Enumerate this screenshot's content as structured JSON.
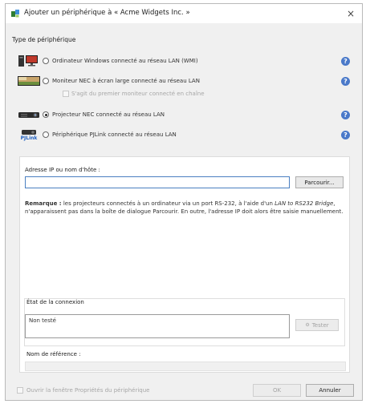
{
  "title": "Ajouter un périphérique à « Acme Widgets Inc. »",
  "close_glyph": "×",
  "device_type": {
    "label": "Type de périphérique",
    "options": [
      {
        "label": "Ordinateur Windows connecté au réseau LAN (WMI)",
        "icon": "computer-icon",
        "selected": false
      },
      {
        "label": "Moniteur NEC à écran large connecté au réseau LAN",
        "icon": "monitor-icon",
        "selected": false
      },
      {
        "label": "Projecteur NEC connecté au réseau LAN",
        "icon": "projector-icon",
        "selected": true
      },
      {
        "label": "Périphérique PJLink connecté au réseau LAN",
        "icon": "pjlink-icon",
        "selected": false
      }
    ],
    "daisy_chain_label": "S'agit du premier moniteur connecté en chaîne",
    "pjlink_text": "PJLink"
  },
  "address": {
    "label": "Adresse IP ou nom d'hôte :",
    "value": "",
    "browse_label": "Parcourir..."
  },
  "remark": {
    "bold": "Remarque :",
    "part1": " les projecteurs connectés à un ordinateur via un port RS-232, à l'aide d'un ",
    "italic": "LAN to RS232 Bridge",
    "part2": ", n'apparaissent pas dans la boîte de dialogue Parcourir. En outre, l'adresse IP doit alors être saisie manuellement."
  },
  "connection": {
    "label": "État de la connexion",
    "status": "Non testé",
    "test_label": "Tester"
  },
  "reference": {
    "label": "Nom de référence  :"
  },
  "footer": {
    "open_props_label": "Ouvrir la fenêtre Propriétés du périphérique",
    "ok_label": "OK",
    "cancel_label": "Annuler"
  },
  "colors": {
    "accent": "#4a79c9",
    "input_border": "#4a7fc1"
  }
}
